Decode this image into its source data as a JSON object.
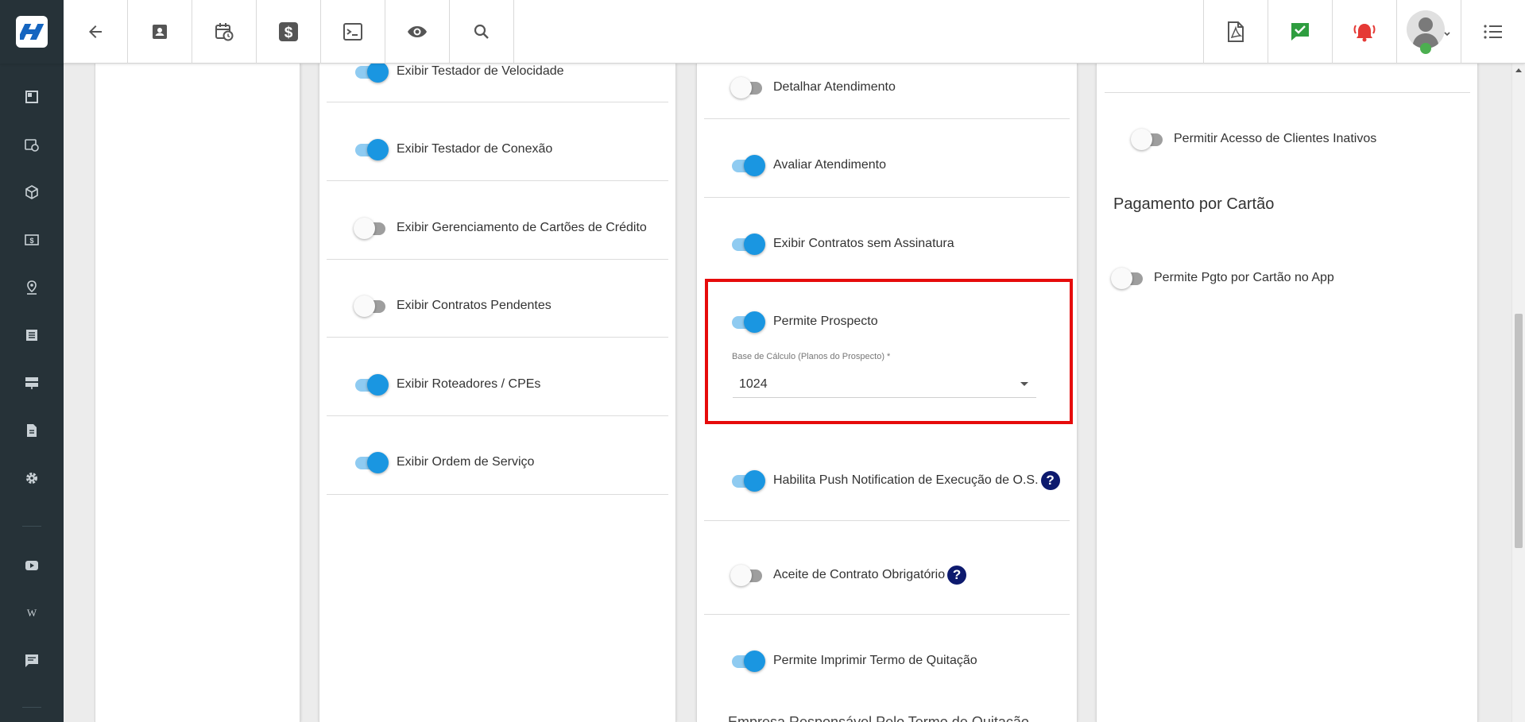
{
  "toolbar": {
    "left_buttons": [
      {
        "name": "back-arrow-icon"
      },
      {
        "name": "contact-card-icon"
      },
      {
        "name": "calendar-clock-icon"
      },
      {
        "name": "dollar-icon"
      },
      {
        "name": "terminal-icon"
      },
      {
        "name": "eye-icon"
      },
      {
        "name": "search-icon"
      }
    ],
    "right_buttons": [
      {
        "name": "pdf-icon"
      },
      {
        "name": "chat-check-icon",
        "color": "#2e9d3f"
      },
      {
        "name": "alarm-bell-icon",
        "color": "#e53935"
      },
      {
        "name": "user-avatar-icon"
      },
      {
        "name": "menu-list-icon"
      }
    ]
  },
  "sidebar": {
    "items": [
      "dashboard-icon",
      "calendar-clock-icon",
      "box-icon",
      "money-icon",
      "map-pin-icon",
      "list-icon",
      "server-icon",
      "document-icon",
      "gear-icon",
      "youtube-icon",
      "wiki-icon",
      "chat-icon"
    ]
  },
  "colors": {
    "toggle_on": "#1a96e1",
    "toggle_off": "#9e9e9e",
    "highlight_border": "#e60b0b",
    "help_icon": "#0d1a6e",
    "sidebar_bg": "#263238"
  },
  "col1": {
    "toggles": [
      {
        "label": "Exibir Testador de Velocidade",
        "on": true
      },
      {
        "label": "Exibir Testador de Conexão",
        "on": true
      },
      {
        "label": "Exibir Gerenciamento de Cartões de Crédito",
        "on": false
      },
      {
        "label": "Exibir Contratos Pendentes",
        "on": false
      },
      {
        "label": "Exibir Roteadores / CPEs",
        "on": true
      },
      {
        "label": "Exibir Ordem de Serviço",
        "on": true
      }
    ]
  },
  "col2": {
    "toggles": [
      {
        "label": "Detalhar Atendimento",
        "on": false
      },
      {
        "label": "Avaliar Atendimento",
        "on": true
      },
      {
        "label": "Exibir Contratos sem Assinatura",
        "on": true
      },
      {
        "label": "Permite Prospecto",
        "on": true
      },
      {
        "label": "Habilita Push Notification de Execução de O.S.",
        "on": true,
        "help": true
      },
      {
        "label": "Aceite de Contrato Obrigatório",
        "on": false,
        "help": true
      },
      {
        "label": "Permite Imprimir Termo de Quitação",
        "on": true
      }
    ],
    "prospect_select": {
      "label": "Base de Cálculo (Planos do Prospecto) *",
      "value": "1024"
    },
    "bottom_text": "Empresa Responsável Pelo Termo de Quitação"
  },
  "col3": {
    "toggle_inactive": {
      "label": "Permitir Acesso de Clientes Inativos",
      "on": false
    },
    "section_title": "Pagamento por Cartão",
    "toggle_card": {
      "label": "Permite Pgto por Cartão no App",
      "on": false
    }
  },
  "help_glyph": "?"
}
